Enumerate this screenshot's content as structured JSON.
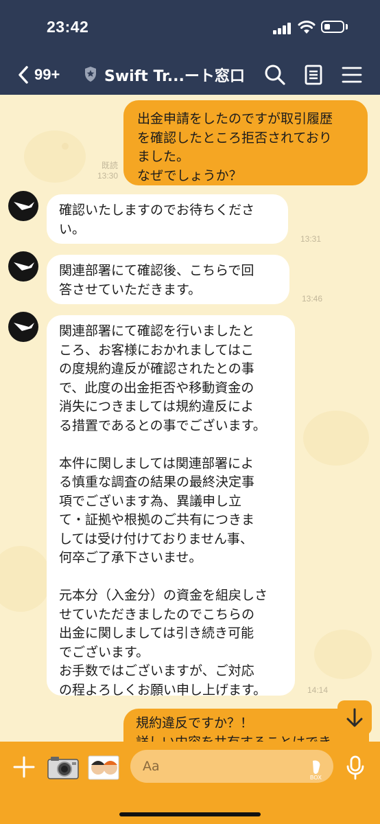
{
  "status_bar": {
    "time": "23:42"
  },
  "header": {
    "back_count": "99+",
    "title": "Swift Tr...ート窓口",
    "icons": [
      "search-icon",
      "notes-icon",
      "menu-icon"
    ]
  },
  "messages": [
    {
      "direction": "outgoing",
      "text": "出金申請をしたのですが取引履歴\nを確認したところ拒否されており\nました。\nなぜでしょうか？",
      "read": "既読",
      "time": "13:30"
    },
    {
      "direction": "incoming",
      "text": "確認いたしますのでお待ちくださ\nい。",
      "time": "13:31"
    },
    {
      "direction": "incoming",
      "text": "関連部署にて確認後、こちらで回\n答させていただきます。",
      "time": "13:46"
    },
    {
      "direction": "incoming",
      "text": "関連部署にて確認を行いましたと\nころ、お客様におかれましてはこ\nの度規約違反が確認されたとの事\nで、此度の出金拒否や移動資金の\n消失につきましては規約違反によ\nる措置であるとの事でございます。\n\n本件に関しましては関連部署によ\nる慎重な調査の結果の最終決定事\n項でございます為、異議申し立\nて・証拠や根拠のご共有につきま\nしては受け付けておりません事、\n何卒ご了承下さいませ。\n\n元本分（入金分）の資金を組戻しさ\nせていただきましたのでこちらの\n出金に関しましては引き続き可能\nでございます。\nお手数ではございますが、ご対応\nの程よろしくお願い申し上げます。",
      "time": "14:14"
    },
    {
      "direction": "outgoing",
      "text": "規約違反ですか？！\n詳しい内容を共有することはでき",
      "time": ""
    }
  ],
  "input": {
    "placeholder": "Aa"
  },
  "colors": {
    "header": "#2e3b56",
    "outgoing_bubble": "#f5a623",
    "incoming_bubble": "#ffffff",
    "chat_bg": "#fbf0cc",
    "bottom_bar": "#f5a623"
  }
}
